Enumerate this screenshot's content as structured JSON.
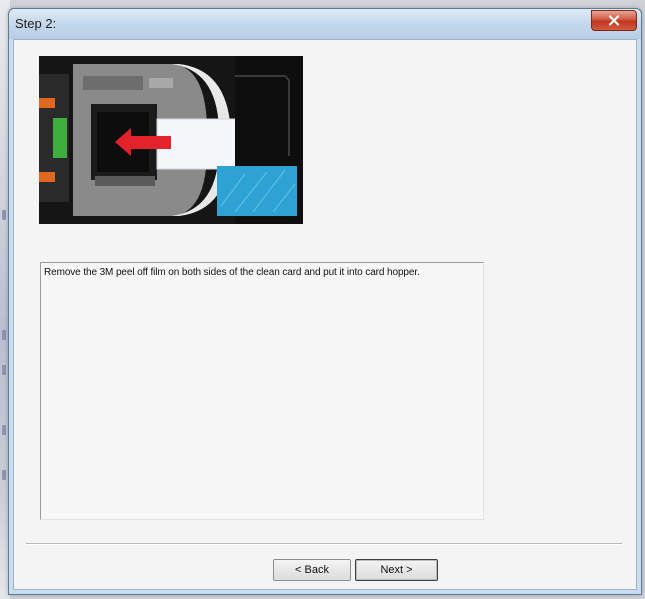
{
  "window": {
    "title": "Step 2:",
    "close_label": "×"
  },
  "image": {
    "description_icon": "card-insertion-photo",
    "arrow_color": "#e3222b",
    "card_color": "#2ea2d3"
  },
  "instructions": {
    "text": "Remove the 3M peel off film on both sides of the clean card and put it into card hopper."
  },
  "buttons": {
    "back_label": "< Back",
    "next_label": "Next >"
  }
}
